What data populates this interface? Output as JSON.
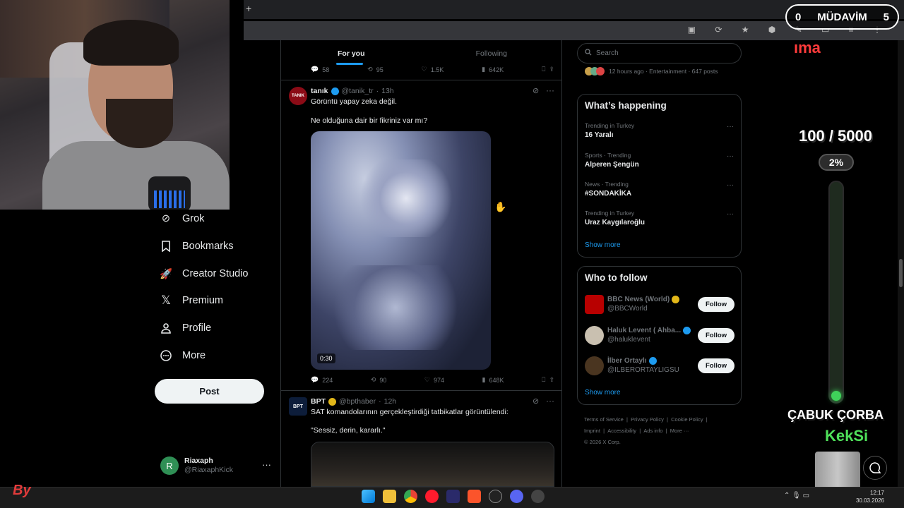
{
  "browser": {
    "new_tab_symbol": "+"
  },
  "nav": {
    "items": [
      {
        "label": "Grok",
        "icon": "grok-icon"
      },
      {
        "label": "Bookmarks",
        "icon": "bookmark-icon"
      },
      {
        "label": "Creator Studio",
        "icon": "rocket-icon"
      },
      {
        "label": "Premium",
        "icon": "x-logo-icon"
      },
      {
        "label": "Profile",
        "icon": "person-icon"
      },
      {
        "label": "More",
        "icon": "more-circle-icon"
      }
    ],
    "post_label": "Post",
    "account": {
      "initial": "R",
      "name": "Riaxaph",
      "handle": "@RiaxaphKick",
      "menu": "···"
    }
  },
  "feed": {
    "tabs": [
      {
        "label": "For you",
        "active": true
      },
      {
        "label": "Following",
        "active": false
      }
    ],
    "prev_actions": {
      "replies": "58",
      "reposts": "95",
      "likes": "1.5K",
      "views": "642K"
    },
    "tweets": [
      {
        "name": "tanık",
        "handle": "@tanik_tr",
        "time": "13h",
        "avatar_text": "TANIK",
        "lines": [
          "Görüntü yapay zeka değil.",
          "Ne olduğuna dair bir fikriniz var mı?"
        ],
        "video_duration": "0:30",
        "actions": {
          "replies": "224",
          "reposts": "90",
          "likes": "974",
          "views": "648K"
        }
      },
      {
        "name": "BPT",
        "handle": "@bpthaber",
        "time": "12h",
        "avatar_text": "BPT",
        "lines": [
          "SAT komandolarının gerçekleştirdiği tatbikatlar görüntülendi:",
          "\"Sessiz, derin, kararlı.\""
        ]
      }
    ]
  },
  "sidebar": {
    "search_placeholder": "Search",
    "top_meta": "12 hours ago · Entertainment · 647 posts",
    "happening_title": "What’s happening",
    "trends": [
      {
        "context": "Trending in Turkey",
        "title": "16 Yaralı"
      },
      {
        "context": "Sports · Trending",
        "title": "Alperen Şengün"
      },
      {
        "context": "News · Trending",
        "title": "#SONDAKİKA"
      },
      {
        "context": "Trending in Turkey",
        "title": "Uraz Kaygılaroğlu"
      }
    ],
    "show_more": "Show more",
    "who_title": "Who to follow",
    "who": [
      {
        "name": "BBC News (World)",
        "handle": "@BBCWorld",
        "badge": "gold",
        "avatar_color": "#b80000"
      },
      {
        "name": "Haluk Levent ( Ahba...",
        "handle": "@haluklevent",
        "badge": "blue",
        "avatar_color": "#c9c0b0"
      },
      {
        "name": "İlber Ortaylı",
        "handle": "@ILBERORTAYLIGSU",
        "badge": "blue",
        "avatar_color": "#4a3520"
      }
    ],
    "follow_label": "Follow",
    "footer": [
      "Terms of Service",
      "|",
      "Privacy Policy",
      "|",
      "Cookie Policy",
      "|",
      "Imprint",
      "|",
      "Accessibility",
      "|",
      "Ads info",
      "|",
      "More ···",
      "© 2026 X Corp."
    ]
  },
  "overlay": {
    "score_left": "0",
    "score_title": "MÜDAVİM",
    "score_right": "5",
    "ima": "ıma",
    "goal": "100 / 5000",
    "percent": "2%",
    "progress": 0.02,
    "corba": "ÇABUK ÇORBA",
    "keksi": "KekSi"
  },
  "taskbar": {
    "time": "12:17",
    "date": "30.03.2026",
    "tray": "⌃ 🎙 ▭",
    "logo": "By"
  }
}
